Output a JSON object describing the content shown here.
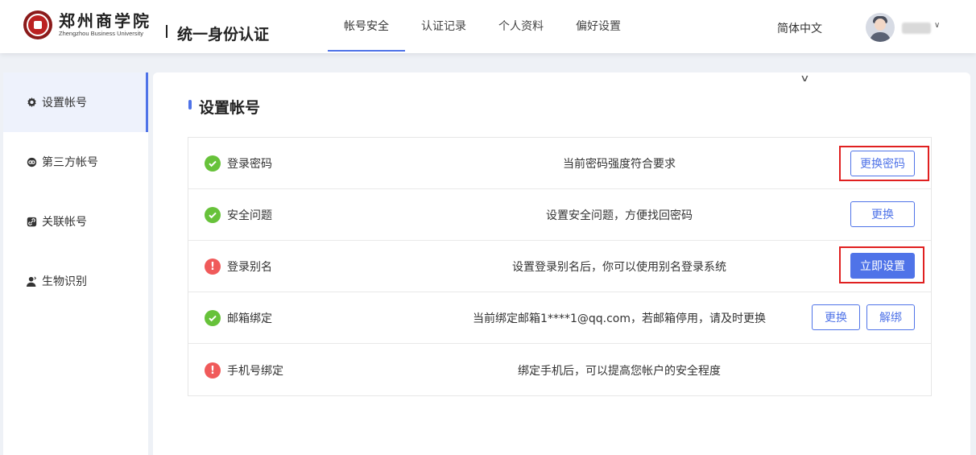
{
  "header": {
    "school_name": "郑州商学院",
    "school_name_en": "Zhengzhou Business University",
    "system_title": "统一身份认证",
    "nav": [
      {
        "label": "帐号安全",
        "active": true
      },
      {
        "label": "认证记录",
        "active": false
      },
      {
        "label": "个人资料",
        "active": false
      },
      {
        "label": "偏好设置",
        "active": false
      }
    ],
    "language": "简体中文"
  },
  "sidebar": {
    "items": [
      {
        "label": "设置帐号",
        "icon": "gear-icon",
        "active": true
      },
      {
        "label": "第三方帐号",
        "icon": "link-circle-icon",
        "active": false
      },
      {
        "label": "关联帐号",
        "icon": "link-icon",
        "active": false
      },
      {
        "label": "生物识别",
        "icon": "person-icon",
        "active": false
      }
    ]
  },
  "main": {
    "title": "设置帐号",
    "rows": [
      {
        "status": "ok",
        "label": "登录密码",
        "desc": "当前密码强度符合要求",
        "buttons": [
          "更换密码"
        ]
      },
      {
        "status": "ok",
        "label": "安全问题",
        "desc": "设置安全问题，方便找回密码",
        "buttons": [
          "更换"
        ]
      },
      {
        "status": "warn",
        "label": "登录别名",
        "desc": "设置登录别名后，你可以使用别名登录系统",
        "buttons": [
          "立即设置"
        ]
      },
      {
        "status": "ok",
        "label": "邮箱绑定",
        "desc": "当前绑定邮箱1****1@qq.com，若邮箱停用，请及时更换",
        "buttons": [
          "更换",
          "解绑"
        ]
      },
      {
        "status": "warn",
        "label": "手机号绑定",
        "desc": "绑定手机后，可以提高您帐户的安全程度",
        "buttons": []
      }
    ]
  },
  "colors": {
    "accent": "#4f73e8",
    "ok": "#67c23a",
    "warn": "#f05a5a",
    "highlight": "#e02020"
  }
}
